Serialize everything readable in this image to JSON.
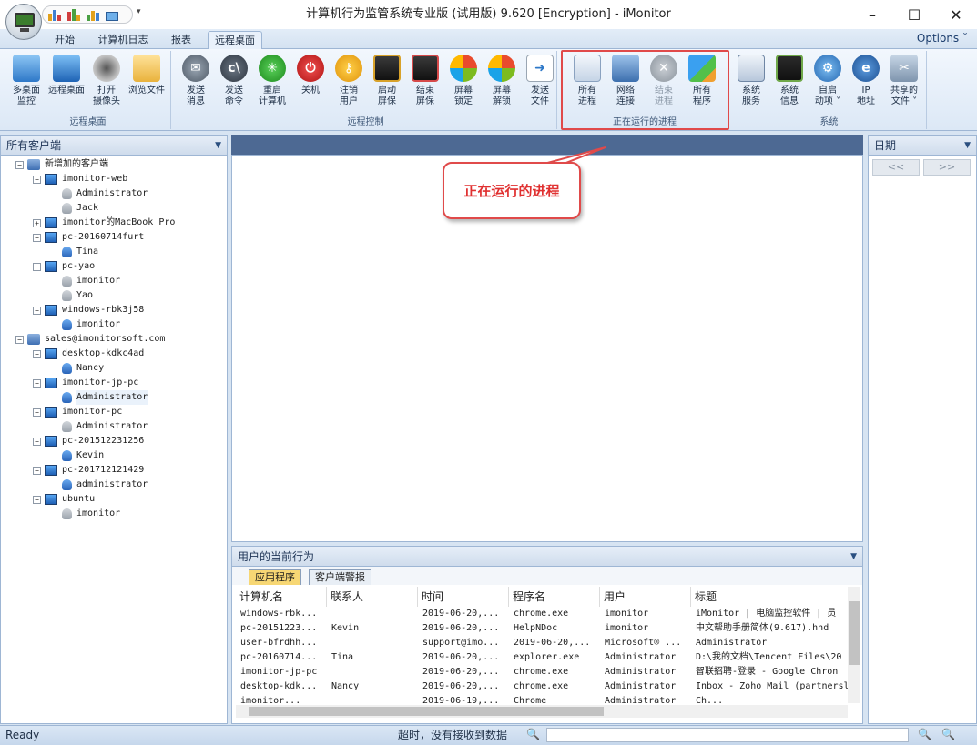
{
  "window": {
    "title": "计算机行为监管系统专业版 (试用版) 9.620 [Encryption] - iMonitor",
    "minimize_glyph": "–",
    "maximize_glyph": "☐",
    "close_glyph": "✕",
    "qat_dropdown": "▾"
  },
  "tabs": [
    "开始",
    "计算机日志",
    "报表",
    "远程桌面"
  ],
  "active_tab": "远程桌面",
  "options_label": "Options ˅",
  "ribbon": {
    "groups": [
      {
        "label": "远程桌面",
        "buttons": [
          "多桌面\n监控",
          "远程桌面",
          "打开\n摄像头",
          "浏览文件"
        ]
      },
      {
        "label": "远程控制",
        "buttons": [
          "发送\n消息",
          "发送\n命令",
          "重启\n计算机",
          "关机",
          "注销\n用户",
          "启动\n屏保",
          "结束\n屏保",
          "屏幕\n锁定",
          "屏幕\n解锁",
          "发送\n文件"
        ]
      },
      {
        "label": "正在运行的进程",
        "buttons": [
          "所有\n进程",
          "网络\n连接",
          "结束\n进程",
          "所有\n程序"
        ]
      },
      {
        "label": "系统",
        "buttons": [
          "系统\n服务",
          "系统\n信息",
          "自启\n动项 ˅",
          "IP\n地址",
          "共享的\n文件 ˅"
        ]
      }
    ]
  },
  "left_panel": {
    "title": "所有客户端",
    "tree": [
      {
        "label": "新增加的客户端",
        "level": 0,
        "type": "network",
        "expanded": true
      },
      {
        "label": "imonitor-web",
        "level": 1,
        "type": "computer",
        "expanded": true
      },
      {
        "label": "Administrator",
        "level": 2,
        "type": "user",
        "online": false
      },
      {
        "label": "Jack",
        "level": 2,
        "type": "user",
        "online": false
      },
      {
        "label": "imonitor的MacBook Pro",
        "level": 1,
        "type": "computer",
        "expanded": false
      },
      {
        "label": "pc-20160714furt",
        "level": 1,
        "type": "computer",
        "expanded": true
      },
      {
        "label": "Tina",
        "level": 2,
        "type": "user",
        "online": true
      },
      {
        "label": "pc-yao",
        "level": 1,
        "type": "computer",
        "expanded": true
      },
      {
        "label": "imonitor",
        "level": 2,
        "type": "user",
        "online": false
      },
      {
        "label": "Yao",
        "level": 2,
        "type": "user",
        "online": false
      },
      {
        "label": "windows-rbk3j58",
        "level": 1,
        "type": "computer",
        "expanded": true
      },
      {
        "label": "imonitor",
        "level": 2,
        "type": "user",
        "online": true
      },
      {
        "label": "sales@imonitorsoft.com",
        "level": 0,
        "type": "network",
        "expanded": true
      },
      {
        "label": "desktop-kdkc4ad",
        "level": 1,
        "type": "computer",
        "expanded": true
      },
      {
        "label": "Nancy",
        "level": 2,
        "type": "user",
        "online": true
      },
      {
        "label": "imonitor-jp-pc",
        "level": 1,
        "type": "computer",
        "expanded": true
      },
      {
        "label": "Administrator",
        "level": 2,
        "type": "user",
        "online": true,
        "selected": true
      },
      {
        "label": "imonitor-pc",
        "level": 1,
        "type": "computer",
        "expanded": true
      },
      {
        "label": "Administrator",
        "level": 2,
        "type": "user",
        "online": false
      },
      {
        "label": "pc-201512231256",
        "level": 1,
        "type": "computer",
        "expanded": true
      },
      {
        "label": "Kevin",
        "level": 2,
        "type": "user",
        "online": true
      },
      {
        "label": "pc-201712121429",
        "level": 1,
        "type": "computer",
        "expanded": true
      },
      {
        "label": "administrator",
        "level": 2,
        "type": "user",
        "online": true
      },
      {
        "label": "ubuntu",
        "level": 1,
        "type": "computer",
        "expanded": true
      },
      {
        "label": "imonitor",
        "level": 2,
        "type": "user",
        "online": false
      }
    ]
  },
  "callout": {
    "text": "正在运行的进程"
  },
  "bottom_panel": {
    "title": "用户的当前行为",
    "tabs": [
      "应用程序",
      "客户端警报"
    ],
    "columns": [
      "计算机名",
      "联系人",
      "时间",
      "程序名",
      "用户",
      "标题"
    ],
    "rows": [
      [
        "windows-rbk...",
        "",
        "2019-06-20,...",
        "chrome.exe",
        "imonitor",
        "iMonitor | 电脑监控软件 | 员"
      ],
      [
        "pc-20151223...",
        "Kevin",
        "2019-06-20,...",
        "HelpNDoc",
        "imonitor",
        "中文帮助手册简体(9.617).hnd"
      ],
      [
        "user-bfrdhh...",
        "",
        "support@imo...",
        "2019-06-20,...",
        "Microsoft® ...",
        "Administrator"
      ],
      [
        "pc-20160714...",
        "Tina",
        "2019-06-20,...",
        "explorer.exe",
        "Administrator",
        "D:\\我的文档\\Tencent Files\\20"
      ],
      [
        "imonitor-jp-pc",
        "",
        "2019-06-20,...",
        "chrome.exe",
        "Administrator",
        "智联招聘-登录 - Google Chron"
      ],
      [
        "desktop-kdk...",
        "Nancy",
        "2019-06-20,...",
        "chrome.exe",
        "Administrator",
        "Inbox - Zoho Mail (partnersl"
      ],
      [
        "imonitor...",
        "",
        "2019-06-19,...",
        "Chrome",
        "Administrator",
        "Ch..."
      ]
    ]
  },
  "right_panel": {
    "title": "日期",
    "prev": "<<",
    "next": ">>"
  },
  "statusbar": {
    "ready": "Ready",
    "message": "超时，没有接收到数据"
  },
  "colors": {
    "highlight": "#e04a4a",
    "accent": "#4d6993"
  }
}
